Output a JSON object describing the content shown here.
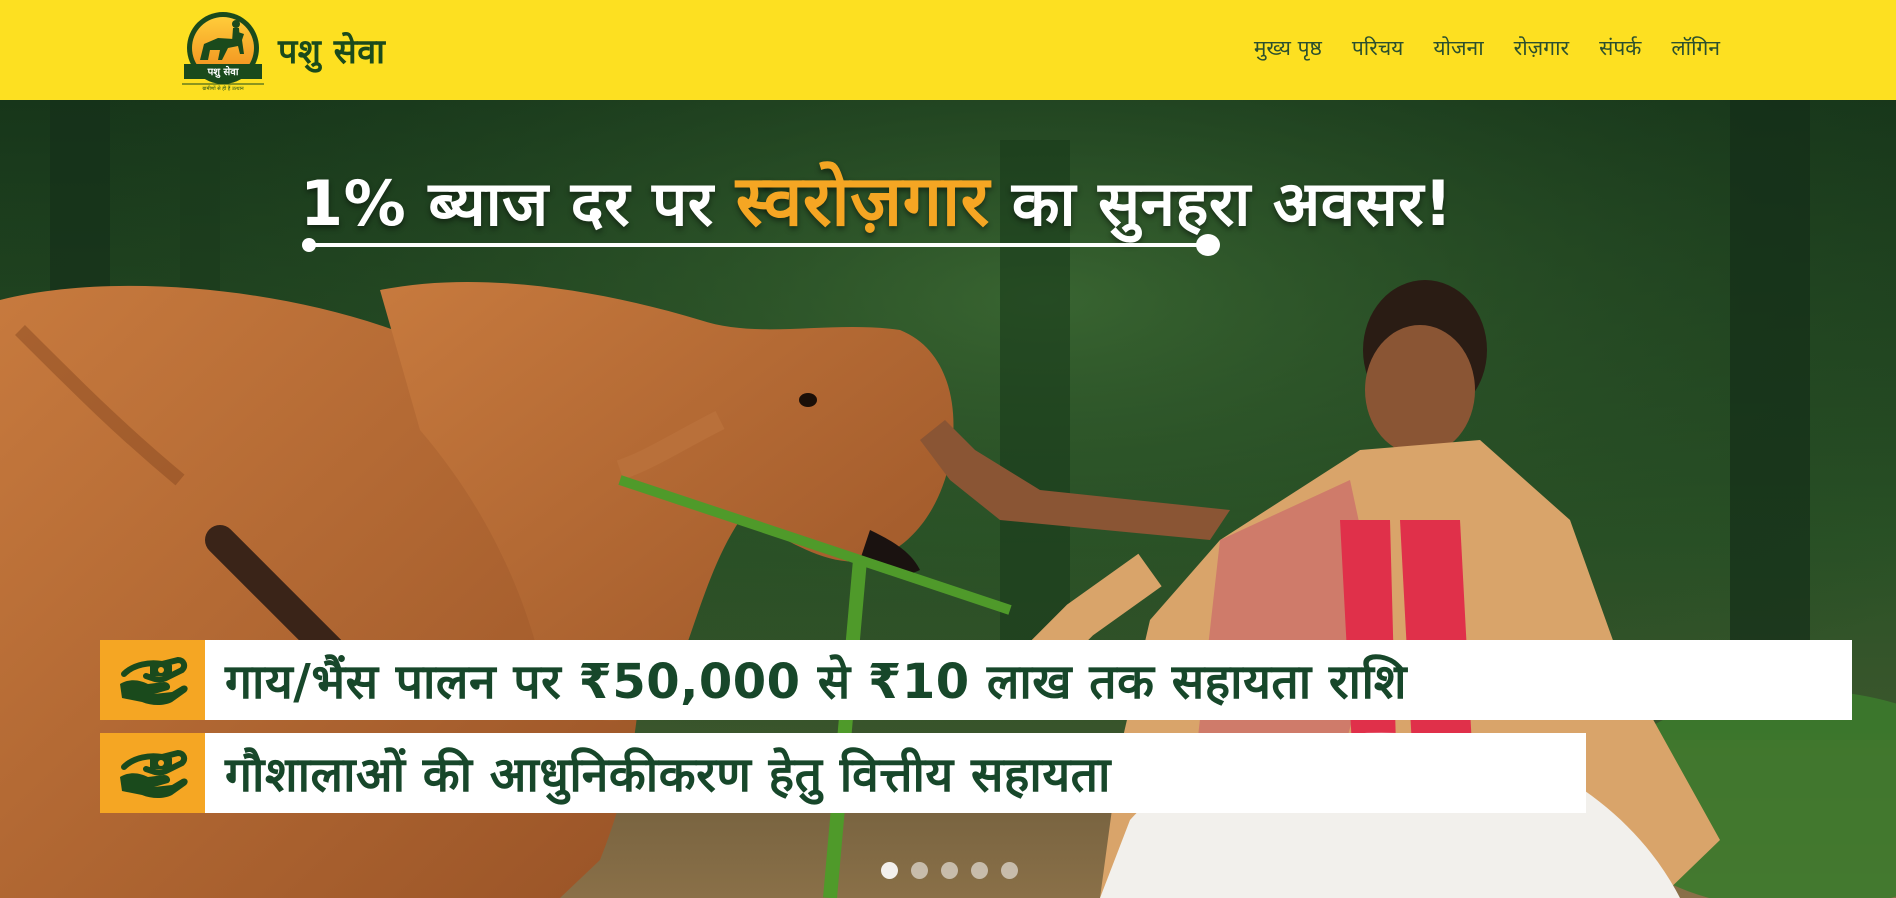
{
  "header": {
    "brand_name": "पशु सेवा",
    "logo_text": "पशु सेवा",
    "logo_tagline": "ग्रामीणों से ही हैं उत्थान",
    "nav": [
      {
        "label": "मुख्य पृष्ठ"
      },
      {
        "label": "परिचय"
      },
      {
        "label": "योजना"
      },
      {
        "label": "रोज़गार"
      },
      {
        "label": "संपर्क"
      },
      {
        "label": "लॉगिन"
      }
    ]
  },
  "hero": {
    "headline_pre": "1% ब्याज दर पर ",
    "headline_highlight": "स्वरोज़गार",
    "headline_post": " का सुनहरा अवसर!",
    "banners": [
      {
        "text": "गाय/भैंस पालन पर ₹50,000 से ₹10 लाख तक सहायता राशि",
        "icon": "hand-money-icon"
      },
      {
        "text": "गौशालाओं की आधुनिकीकरण हेतु वित्तीय सहायता",
        "icon": "hand-money-icon"
      }
    ],
    "slide_count": 5,
    "active_slide": 1
  },
  "colors": {
    "header_bg": "#fde021",
    "brand_green": "#1a4a1c",
    "accent_orange": "#f5a623",
    "banner_text": "#17472a"
  }
}
